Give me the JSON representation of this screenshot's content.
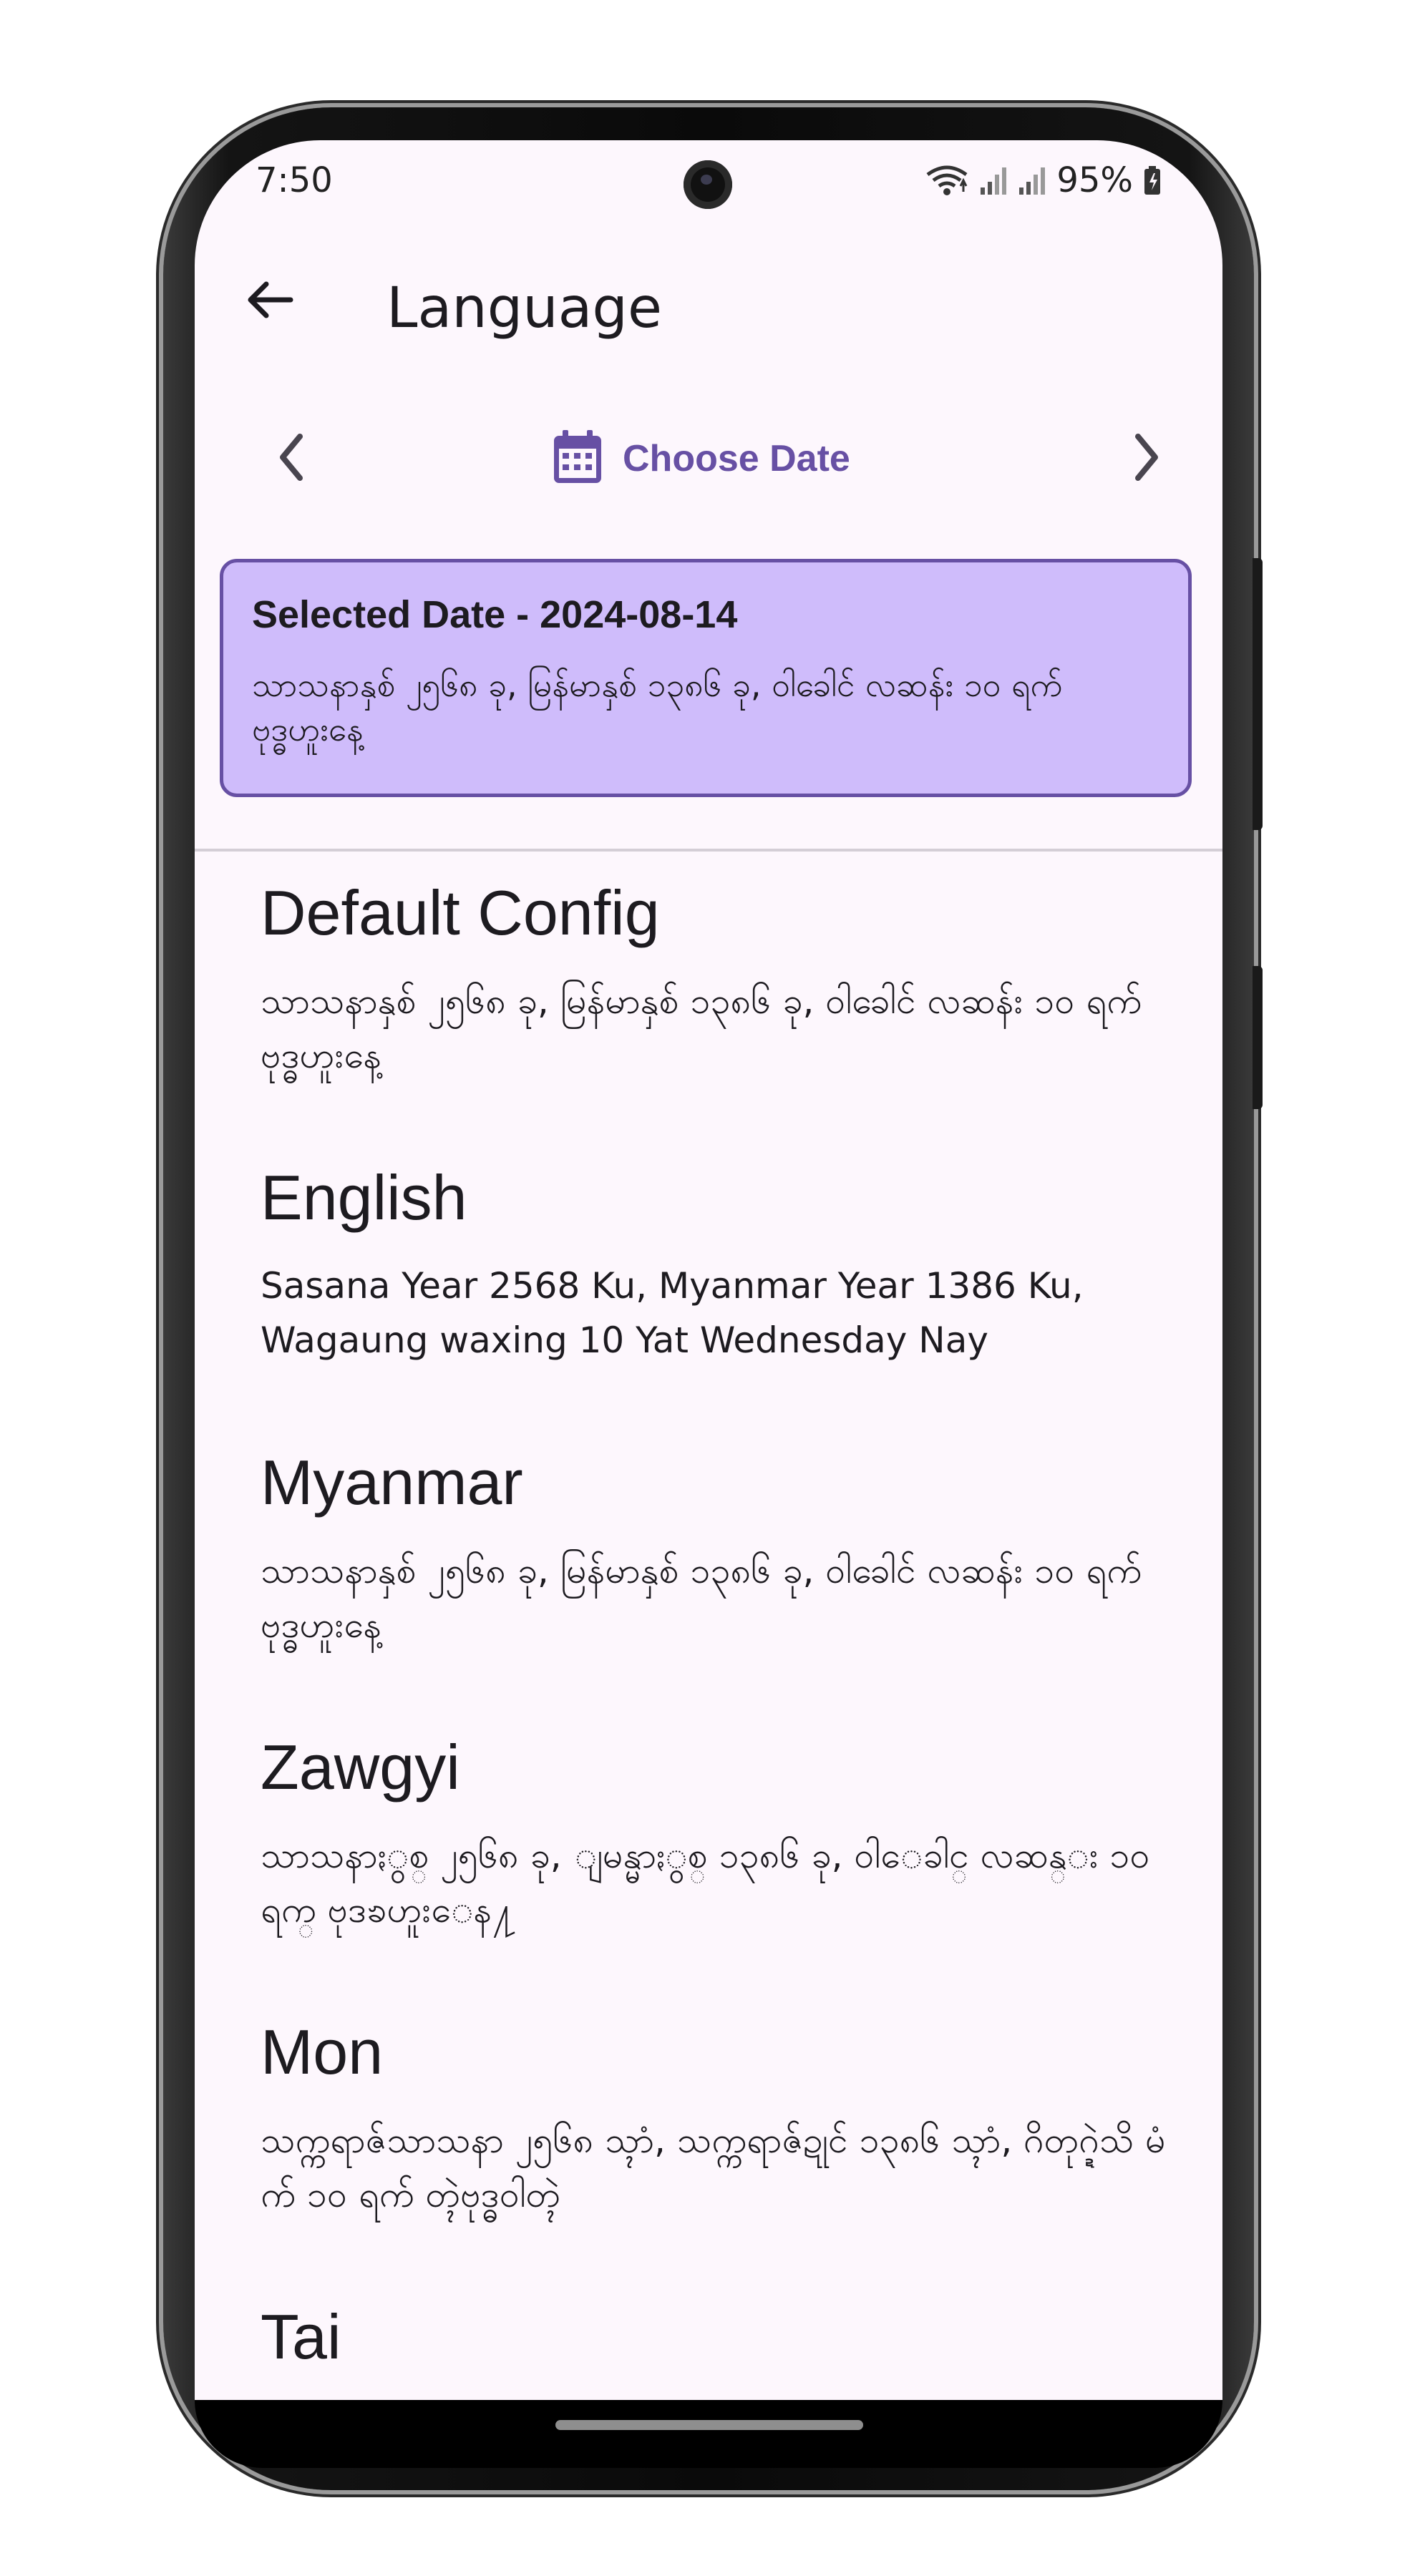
{
  "status_bar": {
    "time": "7:50",
    "battery": "95%",
    "icons": [
      "wifi-icon",
      "signal-icon",
      "signal-icon",
      "battery-icon"
    ]
  },
  "app_bar": {
    "title": "Language",
    "back_icon": "arrow-left-icon"
  },
  "date_nav": {
    "prev_icon": "chevron-left-icon",
    "next_icon": "chevron-right-icon",
    "calendar_icon": "calendar-icon",
    "label": "Choose Date"
  },
  "selected": {
    "title": "Selected Date - 2024-08-14",
    "text": "သာသနာနှစ် ၂၅၆၈ ခု, မြန်မာနှစ် ၁၃၈၆ ခု, ဝါခေါင် လဆန်း ၁၀ ရက် ဗုဒ္ဓဟူးနေ့"
  },
  "languages": [
    {
      "name": "Default Config",
      "text": "သာသနာနှစ် ၂၅၆၈ ခု, မြန်မာနှစ် ၁၃၈၆ ခု, ဝါခေါင် လဆန်း ၁၀ ရက် ဗုဒ္ဓဟူးနေ့"
    },
    {
      "name": "English",
      "text": "Sasana Year 2568 Ku, Myanmar Year 1386 Ku, Wagaung waxing 10 Yat Wednesday Nay"
    },
    {
      "name": "Myanmar",
      "text": "သာသနာနှစ် ၂၅၆၈ ခု, မြန်မာနှစ် ၁၃၈၆ ခု, ဝါခေါင် လဆန်း ၁၀ ရက် ဗုဒ္ဓဟူးနေ့"
    },
    {
      "name": "Zawgyi",
      "text": "သာသနာႏွစ္ ၂၅၆၈ ခု, ျမန္မာႏွစ္ ၁၃၈၆ ခု, ဝါေခါင္ လဆန္း ၁၀ ရက္ ဗုဒၶဟူးေန႔"
    },
    {
      "name": "Mon",
      "text": "သက္ကရာဇ်သာသနာ ၂၅၆၈ သ္ၚာံ, သက္ကရာဇ်ဍုင် ၁၃၈၆ သ္ၚာံ, ဂိတုဂ္ဍဲသိ မံက် ၁၀ ရက် တ္ၚဲဗုဒ္ဓဝါတ္ၚဲ"
    },
    {
      "name": "Tai",
      "text": ""
    }
  ],
  "colors": {
    "accent": "#6750a4",
    "card_bg": "#cfbcfb",
    "screen_bg": "#fdf7fd"
  }
}
